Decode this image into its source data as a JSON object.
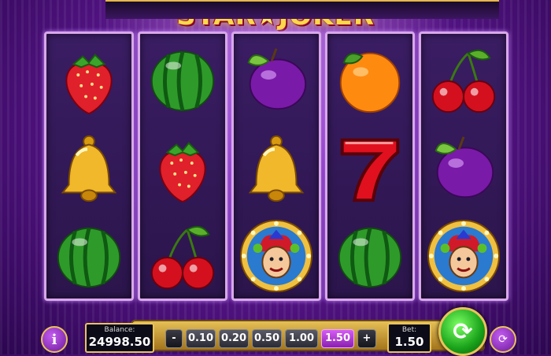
{
  "game": {
    "title_part1": "STAR",
    "title_star": "★",
    "title_part2": "JOKER"
  },
  "reels": [
    [
      "strawberry",
      "bell",
      "watermelon"
    ],
    [
      "watermelon",
      "strawberry",
      "cherries"
    ],
    [
      "plum",
      "bell",
      "joker"
    ],
    [
      "orange",
      "seven",
      "watermelon"
    ],
    [
      "cherries",
      "plum",
      "joker"
    ]
  ],
  "seven_label": "7",
  "controls": {
    "info_icon": "i",
    "balance_label": "Balance:",
    "balance_value": "24998.50",
    "minus_label": "-",
    "bet_options": [
      "0.10",
      "0.20",
      "0.50",
      "1.00",
      "1.50"
    ],
    "plus_label": "+",
    "bet_label": "Bet:",
    "bet_value": "1.50",
    "spin_icon": "⟳",
    "autoplay_icon": "⟳"
  },
  "selected_bet": "1.50",
  "colors": {
    "accent_purple": "#8b2cc4",
    "gold": "#e9c45a",
    "spin_green": "#19a21a",
    "selected_bet": "#d65cf5"
  }
}
